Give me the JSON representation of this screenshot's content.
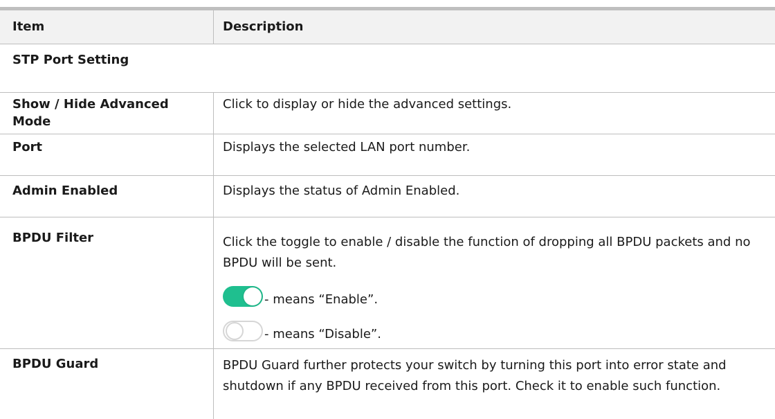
{
  "header": {
    "item": "Item",
    "description": "Description"
  },
  "section": {
    "title": "STP Port Setting"
  },
  "rows": [
    {
      "item": "Show / Hide Advanced Mode",
      "description": "Click to display or hide the advanced settings."
    },
    {
      "item": "Port",
      "description": "Displays the selected LAN port number."
    },
    {
      "item": "Admin Enabled",
      "description": "Displays the status of Admin Enabled."
    },
    {
      "item": "BPDU Filter",
      "description": "Click the toggle to enable / disable the function of dropping all BPDU packets and no BPDU will be sent.",
      "enable_caption": "- means “Enable”.",
      "disable_caption": "- means “Disable”."
    },
    {
      "item": "BPDU Guard",
      "description": "BPDU Guard further protects your switch by turning this port into error state and shutdown if any BPDU received from this port. Check it to enable such function."
    }
  ],
  "colors": {
    "toggle_on": "#1fbf8f",
    "toggle_off_border": "#d6d6d6",
    "header_bg": "#f2f2f2"
  },
  "icons": {
    "toggle_enabled": "toggle-on-icon",
    "toggle_disabled": "toggle-off-icon"
  }
}
